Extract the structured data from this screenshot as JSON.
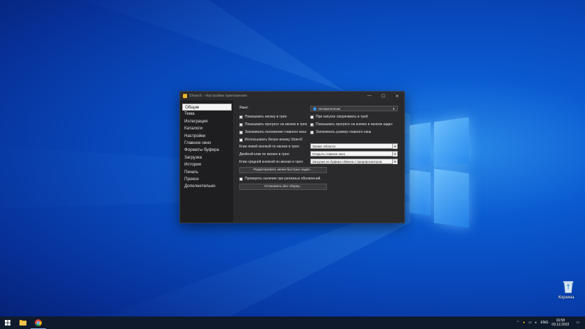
{
  "desktop": {
    "recycle_bin_label": "Корзина"
  },
  "window": {
    "title": "ShareX - Настройки приложения",
    "controls": {
      "minimize": "—",
      "maximize": "☐",
      "close": "✕"
    }
  },
  "sidebar": {
    "items": [
      {
        "label": "Общие"
      },
      {
        "label": "Тема"
      },
      {
        "label": "Интеграция"
      },
      {
        "label": "Каталоги"
      },
      {
        "label": "Настройки"
      },
      {
        "label": "Главное окно"
      },
      {
        "label": "Форматы буфера"
      },
      {
        "label": "Загрузка"
      },
      {
        "label": "История"
      },
      {
        "label": "Печать"
      },
      {
        "label": "Прокси"
      },
      {
        "label": "Дополнительно"
      }
    ],
    "active_index": 0
  },
  "general": {
    "language_label": "Язык:",
    "language_value": "Автоматически",
    "checkboxes": [
      {
        "label": "Показывать иконку в трее",
        "checked": true
      },
      {
        "label": "При запуске сворачивать в трей",
        "checked": false
      },
      {
        "label": "Показывать прогресс на иконке в трее",
        "checked": true
      },
      {
        "label": "Показывать прогресс на кнопке в панели задач",
        "checked": true
      },
      {
        "label": "Запоминать положение главного окна",
        "checked": false
      },
      {
        "label": "Запоминать размер главного окна",
        "checked": false
      },
      {
        "label": "Использовать белую иконку ShareX",
        "checked": false
      }
    ],
    "tray_actions": [
      {
        "label": "Клик левой кнопкой по иконке в трее:",
        "value": "Захват области"
      },
      {
        "label": "Двойной клик по иконке в трее:",
        "value": "Открыть главное окно"
      },
      {
        "label": "Клик средней кнопкой по иконке в трее:",
        "value": "Загрузка из буфера обмена с предпросмотром"
      }
    ],
    "edit_menu_button": "Редактировать меню быстрых задач...",
    "prerelease_checkbox": {
      "label": "Проверять наличие пре-релизных обновлений",
      "checked": false
    },
    "dev_build_button": "Установить dev сборку..."
  },
  "taskbar": {
    "language": "ENG",
    "time": "16:58",
    "date": "03.12.2022"
  }
}
